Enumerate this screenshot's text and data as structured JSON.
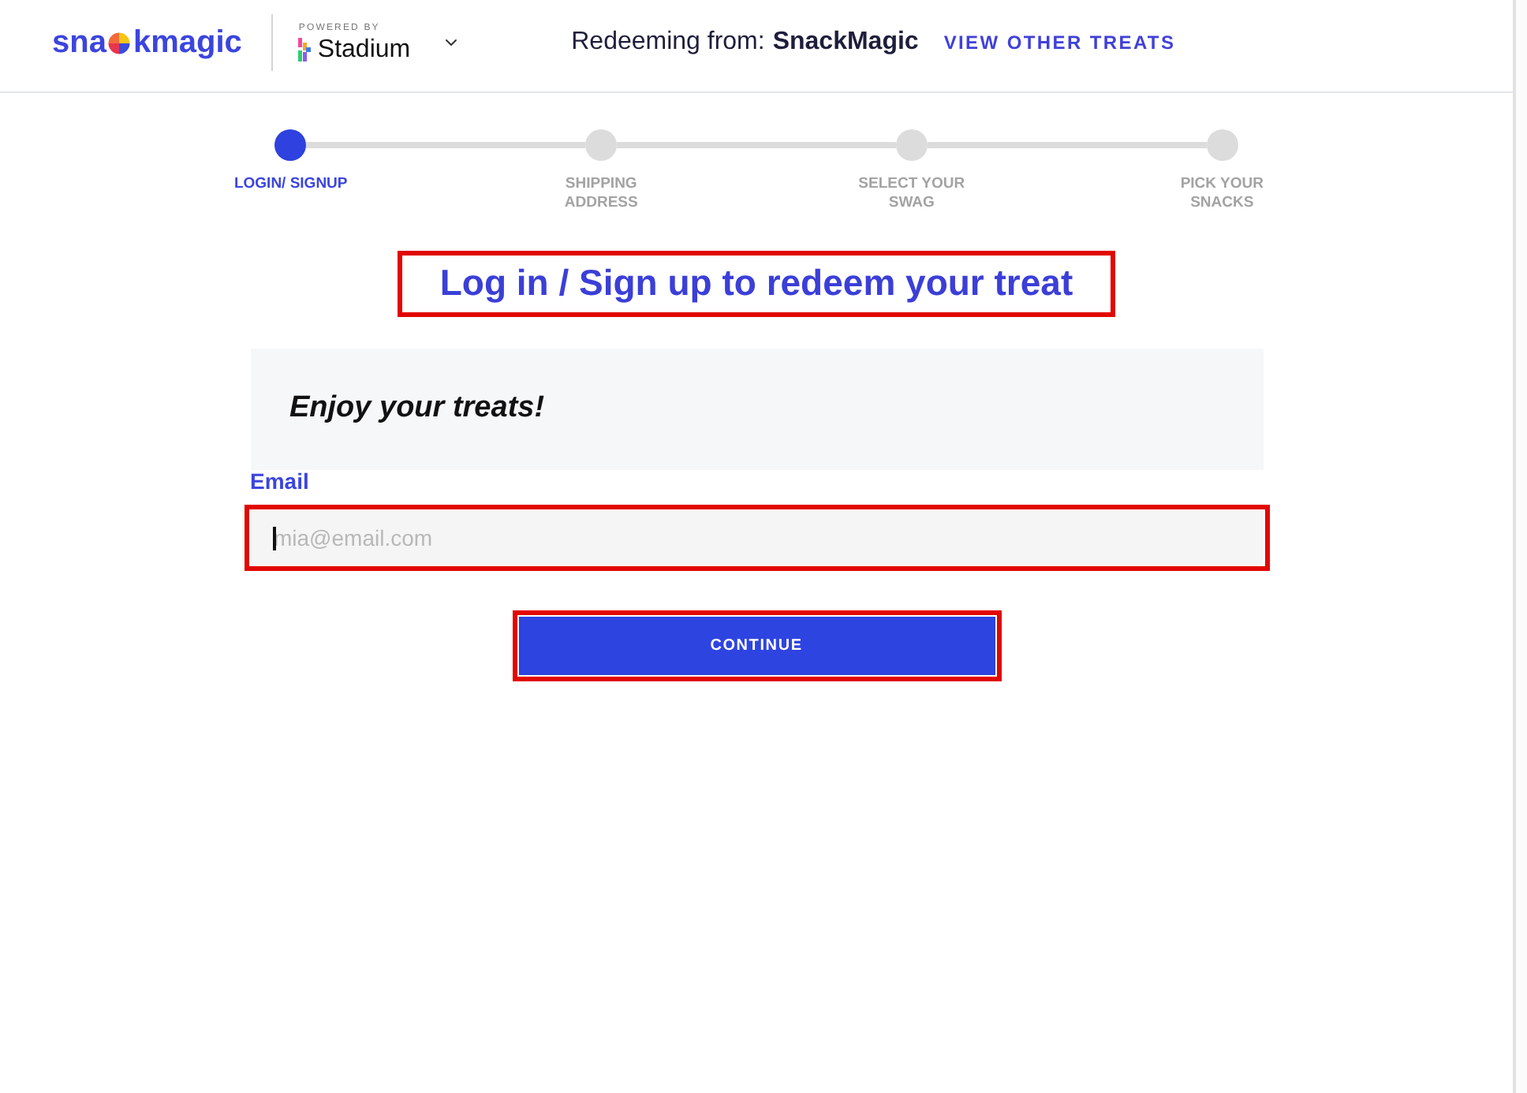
{
  "header": {
    "logo": {
      "text_start": "sna",
      "text_end": "kmagic"
    },
    "powered_by": "POWERED BY",
    "partner": "Stadium",
    "redeeming_label": "Redeeming from:",
    "redeeming_source": "SnackMagic",
    "link": "VIEW OTHER TREATS"
  },
  "steps": [
    {
      "label": "LOGIN/ SIGNUP",
      "current": true
    },
    {
      "label": "SHIPPING ADDRESS",
      "current": false
    },
    {
      "label": "SELECT YOUR SWAG",
      "current": false
    },
    {
      "label": "PICK YOUR SNACKS",
      "current": false
    }
  ],
  "heading": {
    "text": "Log in / Sign up to redeem your treat",
    "highlighted": true
  },
  "message": "Enjoy your treats!",
  "email": {
    "label": "Email",
    "placeholder": "mia@email.com",
    "focused": true,
    "highlighted": true
  },
  "continue_button": {
    "label": "CONTINUE",
    "highlighted": true
  }
}
